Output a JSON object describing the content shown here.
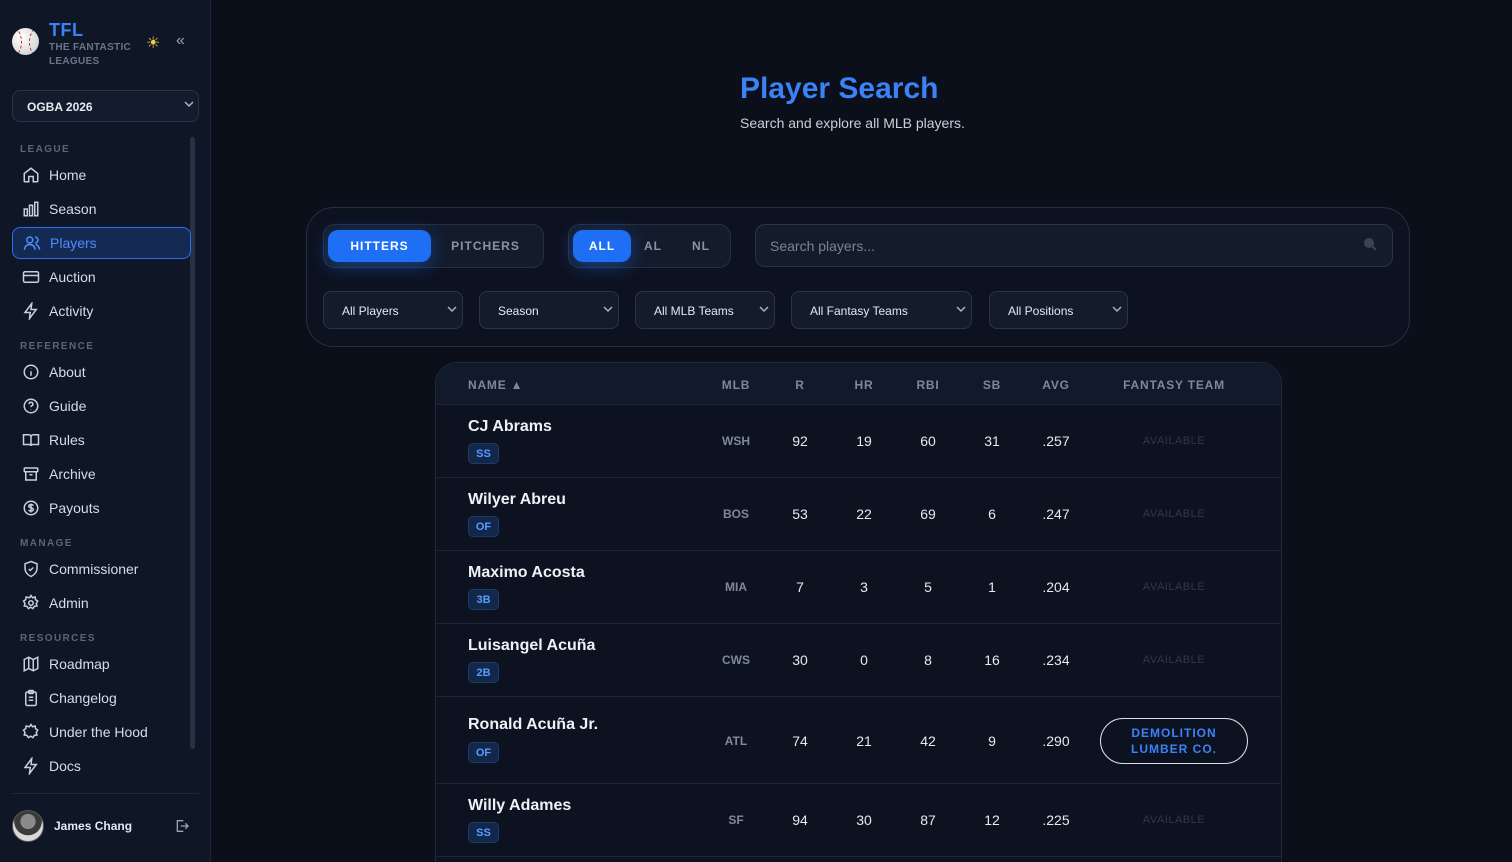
{
  "sidebar": {
    "brand_title": "TFL",
    "brand_subtitle": "THE FANTASTIC LEAGUES",
    "league": "OGBA 2026",
    "sections": {
      "league": "LEAGUE",
      "reference": "REFERENCE",
      "manage": "MANAGE",
      "resources": "RESOURCES"
    },
    "items": {
      "home": "Home",
      "season": "Season",
      "players": "Players",
      "auction": "Auction",
      "activity": "Activity",
      "about": "About",
      "guide": "Guide",
      "rules": "Rules",
      "archive": "Archive",
      "payouts": "Payouts",
      "commissioner": "Commissioner",
      "admin": "Admin",
      "roadmap": "Roadmap",
      "changelog": "Changelog",
      "under_the_hood": "Under the Hood",
      "docs": "Docs"
    },
    "user_name": "James Chang",
    "theme_icon": "sun-icon"
  },
  "header": {
    "title": "Player Search",
    "subtitle": "Search and explore all MLB players."
  },
  "filters": {
    "type_hitters": "HITTERS",
    "type_pitchers": "PITCHERS",
    "league_all": "ALL",
    "league_al": "AL",
    "league_nl": "NL",
    "search_placeholder": "Search players...",
    "dd_players": "All Players",
    "dd_season": "Season",
    "dd_mlb_teams": "All MLB Teams",
    "dd_fantasy_teams": "All Fantasy Teams",
    "dd_positions": "All Positions"
  },
  "table": {
    "columns": {
      "name": "NAME ▲",
      "mlb": "MLB",
      "r": "R",
      "hr": "HR",
      "rbi": "RBI",
      "sb": "SB",
      "avg": "AVG",
      "fantasy_team": "FANTASY TEAM"
    },
    "rows": [
      {
        "name": "CJ Abrams",
        "pos": "SS",
        "mlb": "WSH",
        "r": "92",
        "hr": "19",
        "rbi": "60",
        "sb": "31",
        "avg": ".257",
        "team": "AVAILABLE"
      },
      {
        "name": "Wilyer Abreu",
        "pos": "OF",
        "mlb": "BOS",
        "r": "53",
        "hr": "22",
        "rbi": "69",
        "sb": "6",
        "avg": ".247",
        "team": "AVAILABLE"
      },
      {
        "name": "Maximo Acosta",
        "pos": "3B",
        "mlb": "MIA",
        "r": "7",
        "hr": "3",
        "rbi": "5",
        "sb": "1",
        "avg": ".204",
        "team": "AVAILABLE"
      },
      {
        "name": "Luisangel Acuña",
        "pos": "2B",
        "mlb": "CWS",
        "r": "30",
        "hr": "0",
        "rbi": "8",
        "sb": "16",
        "avg": ".234",
        "team": "AVAILABLE"
      },
      {
        "name": "Ronald Acuña Jr.",
        "pos": "OF",
        "mlb": "ATL",
        "r": "74",
        "hr": "21",
        "rbi": "42",
        "sb": "9",
        "avg": ".290",
        "team": "DEMOLITION LUMBER CO."
      },
      {
        "name": "Willy Adames",
        "pos": "SS",
        "mlb": "SF",
        "r": "94",
        "hr": "30",
        "rbi": "87",
        "sb": "12",
        "avg": ".225",
        "team": "AVAILABLE"
      }
    ]
  },
  "colors": {
    "accent": "#3b82f6",
    "background": "#0b0f19",
    "sidebar": "#0f1626"
  }
}
